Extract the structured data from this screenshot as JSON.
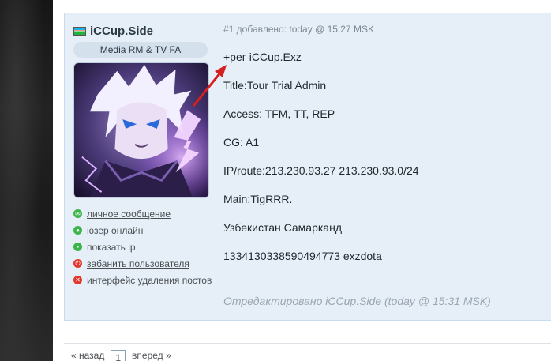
{
  "author": {
    "name": "iCCup.Side",
    "flag_icon": "uzbekistan-flag-icon",
    "title": "Media RM & TV FA",
    "actions": [
      {
        "label": "личное сообщение",
        "icon": "message-icon",
        "color": "#3bb54a",
        "link": true
      },
      {
        "label": "юзер онлайн",
        "icon": "online-icon",
        "color": "#3bb54a",
        "link": false
      },
      {
        "label": "показать ip",
        "icon": "ip-icon",
        "color": "#3bb54a",
        "link": false
      },
      {
        "label": "забанить пользователя",
        "icon": "ban-icon",
        "color": "#e1382d",
        "link": true
      },
      {
        "label": "интерфейс удаления постов",
        "icon": "delete-icon",
        "color": "#e1382d",
        "link": false
      }
    ]
  },
  "post": {
    "meta": "#1 добавлено: today @ 15:27 MSK",
    "lines": [
      "+рег iCCup.Exz",
      "Title:Tour Trial Admin",
      "Access: TFM, TT, REP",
      "CG: A1",
      "IP/route:213.230.93.27 213.230.93.0/24",
      "Main:TigRRR.",
      "Узбекистан Самарканд",
      "1334130338590494773 exzdota"
    ],
    "edited": "Отредактировано iCCup.Side (today @ 15:31 MSK)"
  },
  "pagination": {
    "prev": "« назад",
    "current": "1",
    "next": "вперед »"
  },
  "colors": {
    "post_bg": "#e6eff7",
    "accent_green": "#3bb54a",
    "accent_red": "#e1382d",
    "annotation_arrow": "#d42020"
  }
}
